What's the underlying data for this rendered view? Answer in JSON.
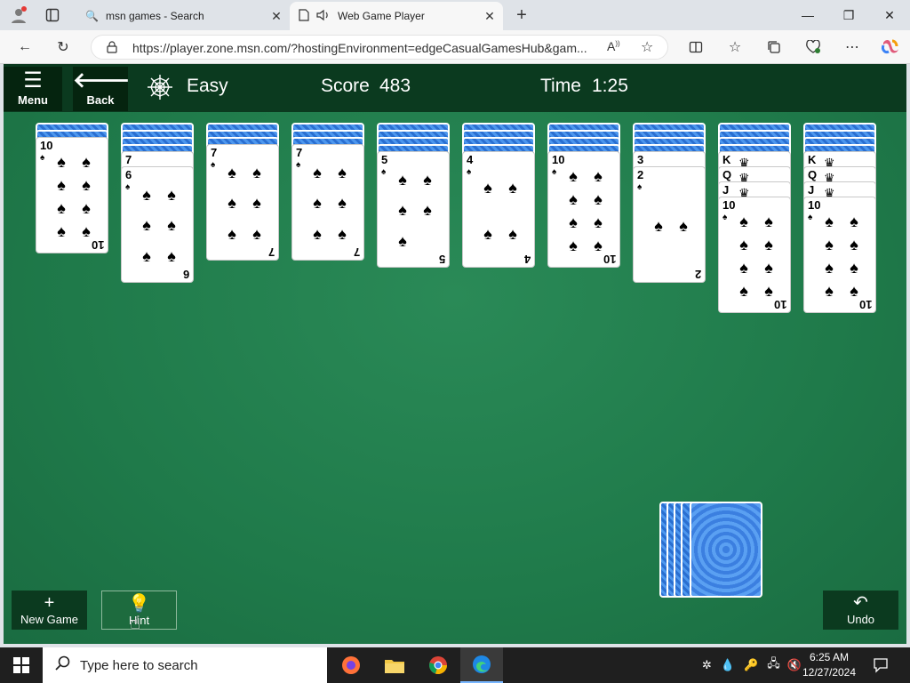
{
  "tabs": [
    {
      "title": "msn games - Search",
      "icon": "search-icon"
    },
    {
      "title": "Web Game Player",
      "icon": "page-icon"
    }
  ],
  "address": {
    "url": "https://player.zone.msn.com/?hostingEnvironment=edgeCasualGamesHub&gam..."
  },
  "game": {
    "menu_label": "Menu",
    "back_label": "Back",
    "difficulty": "Easy",
    "score_label": "Score",
    "score_value": "483",
    "time_label": "Time",
    "time_value": "1:25",
    "new_game_label": "New Game",
    "hint_label": "Hint",
    "undo_label": "Undo"
  },
  "tableau": [
    {
      "hidden": 2,
      "peeks": [],
      "top": "10"
    },
    {
      "hidden": 4,
      "peeks": [
        "7"
      ],
      "top": "6"
    },
    {
      "hidden": 3,
      "peeks": [],
      "top": "7"
    },
    {
      "hidden": 3,
      "peeks": [],
      "top": "7"
    },
    {
      "hidden": 4,
      "peeks": [],
      "top": "5"
    },
    {
      "hidden": 4,
      "peeks": [],
      "top": "4"
    },
    {
      "hidden": 4,
      "peeks": [],
      "top": "10"
    },
    {
      "hidden": 4,
      "peeks": [
        "3"
      ],
      "top": "2"
    },
    {
      "hidden": 4,
      "peeks": [
        "K",
        "Q",
        "J"
      ],
      "top": "10"
    },
    {
      "hidden": 4,
      "peeks": [
        "K",
        "Q",
        "J"
      ],
      "top": "10"
    }
  ],
  "taskbar": {
    "search_placeholder": "Type here to search",
    "time": "6:25 AM",
    "date": "12/27/2024"
  }
}
